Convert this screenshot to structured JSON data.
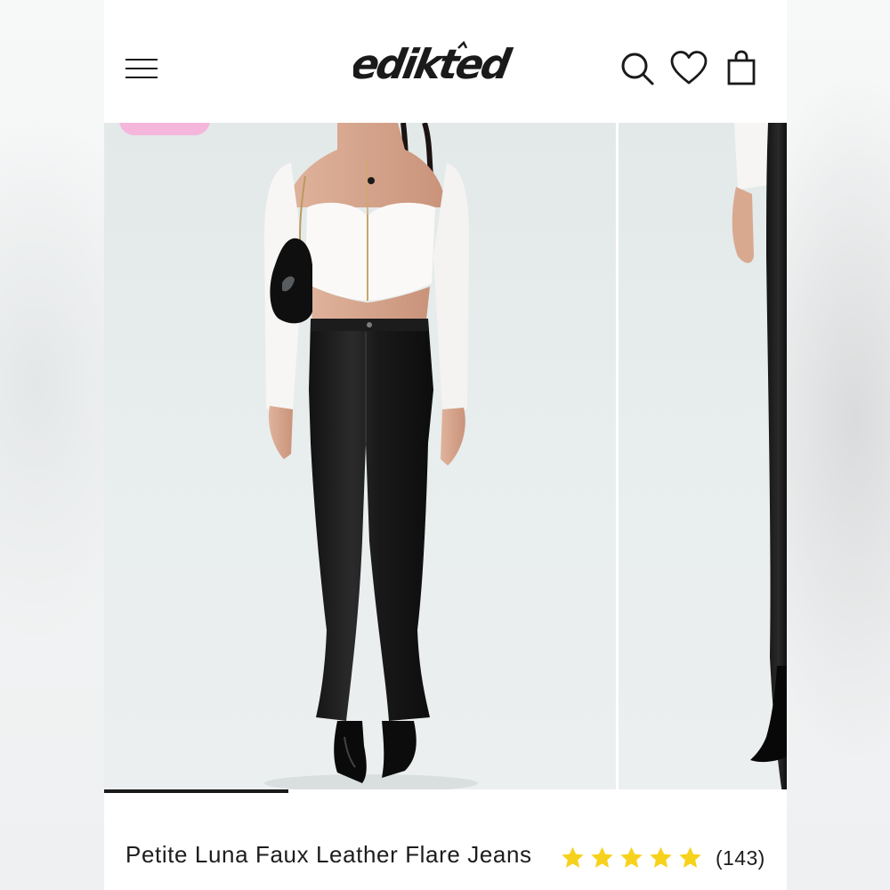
{
  "header": {
    "brand": "edikted",
    "menu_icon": "hamburger-icon",
    "search_icon": "search-icon",
    "wishlist_icon": "heart-icon",
    "cart_icon": "shopping-bag-icon"
  },
  "gallery": {
    "current_slide": 1,
    "progress_fraction": 0.27,
    "badge_color": "#f5b6dc",
    "slides": [
      {
        "alt": "model wearing white corset top and black faux leather flare jeans"
      },
      {
        "alt": "side view of black faux leather flare jeans"
      }
    ]
  },
  "product": {
    "title": "Petite Luna Faux Leather Flare Jeans",
    "rating_stars": 5,
    "review_count": "(143)",
    "star_color": "#f7d21d"
  },
  "colors": {
    "text": "#1d1d1d",
    "progress": "#1a1a1a"
  }
}
